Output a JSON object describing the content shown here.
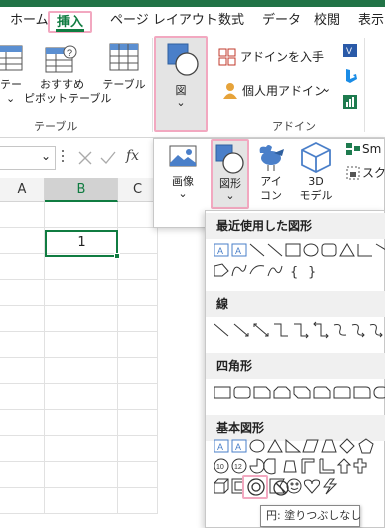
{
  "tabs": [
    "ホーム",
    "挿入",
    "ページ レイアウト",
    "数式",
    "データ",
    "校閲",
    "表示"
  ],
  "active_tab": "挿入",
  "ribbon": {
    "pivot_table_partial": "テー",
    "recommended_pivot_line1": "おすすめ",
    "recommended_pivot_line2": "ピボットテーブル",
    "table": "テーブル",
    "group_table": "テーブル",
    "illustrations": "図",
    "get_addins": "アドインを入手",
    "my_addins": "個人用アドイン",
    "group_addins": "アドイン"
  },
  "formula_bar": {
    "fx": "fx"
  },
  "grid": {
    "columns": [
      "A",
      "B",
      "C"
    ],
    "active_cell_value": "1"
  },
  "illustrations_menu": {
    "picture_line1": "画像",
    "shapes_line1": "図形",
    "icons_line1": "アイ",
    "icons_line2": "コン",
    "models_line1": "3D",
    "models_line2": "モデル",
    "smartart_partial": "Sm",
    "screenshot_partial": "スクリ"
  },
  "shapes_gallery": {
    "recent": "最近使用した図形",
    "lines": "線",
    "rectangles": "四角形",
    "basic": "基本図形",
    "tooltip": "円: 塗りつぶしなし"
  },
  "colors": {
    "accent": "#217346",
    "highlight": "#f2a8c0",
    "selected_green": "#107c41"
  }
}
